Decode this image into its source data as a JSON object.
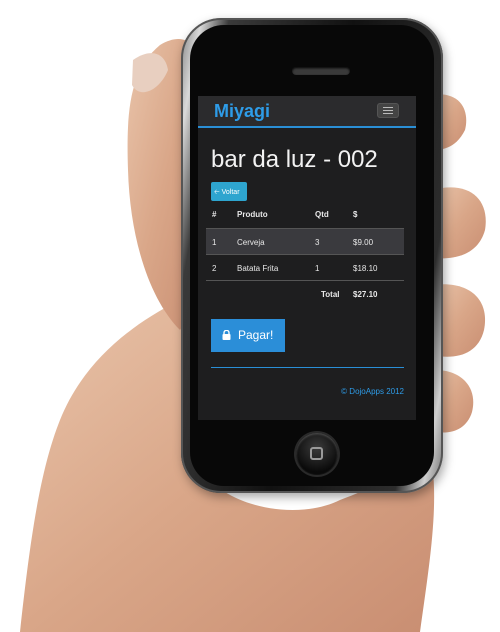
{
  "app": {
    "brand": "Miyagi"
  },
  "page": {
    "title": "bar da luz - 002",
    "back_label": "Voltar"
  },
  "table": {
    "headers": [
      "#",
      "Produto",
      "Qtd",
      "$"
    ],
    "rows": [
      [
        "1",
        "Cerveja",
        "3",
        "$9.00"
      ],
      [
        "2",
        "Batata Frita",
        "1",
        "$18.10"
      ]
    ],
    "total_label": "Total",
    "total_value": "$27.10"
  },
  "actions": {
    "pay_label": "Pagar!"
  },
  "footer": {
    "text": "© DojoApps 2012"
  },
  "colors": {
    "accent": "#2e9ce8",
    "background": "#1e1e1f",
    "navbar": "#2b2b2d",
    "back_button": "#2ea5cf"
  },
  "icons": [
    "hamburger-icon",
    "arrow-left-icon",
    "lock-icon"
  ]
}
